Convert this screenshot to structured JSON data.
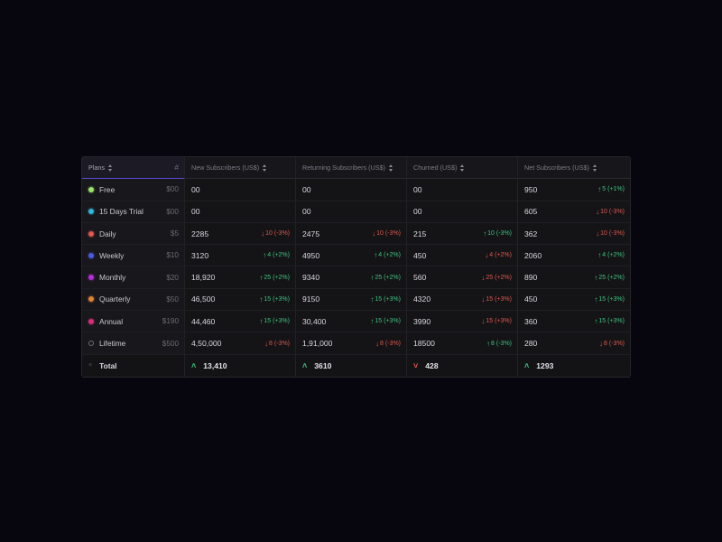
{
  "headers": {
    "plans": "Plans",
    "hash": "#",
    "new": "New Subscribers (US$)",
    "returning": "Returning Subscribers (US$)",
    "churned": "Churned (US$)",
    "net": "Net Subscribers (US$)"
  },
  "rows": [
    {
      "plan": "Free",
      "price": "$00",
      "dot": "#9be36b",
      "new": {
        "value": "00",
        "delta": "",
        "dir": ""
      },
      "ret": {
        "value": "00",
        "delta": "",
        "dir": ""
      },
      "churn": {
        "value": "00",
        "delta": "",
        "dir": ""
      },
      "net": {
        "value": "950",
        "delta": "5 (+1%)",
        "dir": "up"
      }
    },
    {
      "plan": "15 Days Trial",
      "price": "$00",
      "dot": "#2fb7d6",
      "new": {
        "value": "00",
        "delta": "",
        "dir": ""
      },
      "ret": {
        "value": "00",
        "delta": "",
        "dir": ""
      },
      "churn": {
        "value": "00",
        "delta": "",
        "dir": ""
      },
      "net": {
        "value": "605",
        "delta": "10 (-3%)",
        "dir": "down"
      }
    },
    {
      "plan": "Daily",
      "price": "$5",
      "dot": "#e0574f",
      "new": {
        "value": "2285",
        "delta": "10 (-3%)",
        "dir": "down"
      },
      "ret": {
        "value": "2475",
        "delta": "10 (-3%)",
        "dir": "down"
      },
      "churn": {
        "value": "215",
        "delta": "10 (-3%)",
        "dir": "up"
      },
      "net": {
        "value": "362",
        "delta": "10 (-3%)",
        "dir": "down"
      }
    },
    {
      "plan": "Weekly",
      "price": "$10",
      "dot": "#4a5be0",
      "new": {
        "value": "3120",
        "delta": "4 (+2%)",
        "dir": "up"
      },
      "ret": {
        "value": "4950",
        "delta": "4 (+2%)",
        "dir": "up"
      },
      "churn": {
        "value": "450",
        "delta": "4 (+2%)",
        "dir": "down"
      },
      "net": {
        "value": "2060",
        "delta": "4 (+2%)",
        "dir": "up"
      }
    },
    {
      "plan": "Monthly",
      "price": "$20",
      "dot": "#b32fd6",
      "new": {
        "value": "18,920",
        "delta": "25 (+2%)",
        "dir": "up"
      },
      "ret": {
        "value": "9340",
        "delta": "25 (+2%)",
        "dir": "up"
      },
      "churn": {
        "value": "560",
        "delta": "25 (+2%)",
        "dir": "down"
      },
      "net": {
        "value": "890",
        "delta": "25 (+2%)",
        "dir": "up"
      }
    },
    {
      "plan": "Quarterly",
      "price": "$50",
      "dot": "#e0842f",
      "new": {
        "value": "46,500",
        "delta": "15 (+3%)",
        "dir": "up"
      },
      "ret": {
        "value": "9150",
        "delta": "15 (+3%)",
        "dir": "up"
      },
      "churn": {
        "value": "4320",
        "delta": "15 (+3%)",
        "dir": "down"
      },
      "net": {
        "value": "450",
        "delta": "15 (+3%)",
        "dir": "up"
      }
    },
    {
      "plan": "Annual",
      "price": "$190",
      "dot": "#d62f78",
      "new": {
        "value": "44,460",
        "delta": "15 (+3%)",
        "dir": "up"
      },
      "ret": {
        "value": "30,400",
        "delta": "15 (+3%)",
        "dir": "up"
      },
      "churn": {
        "value": "3990",
        "delta": "15 (+3%)",
        "dir": "down"
      },
      "net": {
        "value": "360",
        "delta": "15 (+3%)",
        "dir": "up"
      }
    },
    {
      "plan": "Lifetime",
      "price": "$500",
      "dot": "ring",
      "new": {
        "value": "4,50,000",
        "delta": "8 (-3%)",
        "dir": "down"
      },
      "ret": {
        "value": "1,91,000",
        "delta": "8 (-3%)",
        "dir": "down"
      },
      "churn": {
        "value": "18500",
        "delta": "8 (-3%)",
        "dir": "up"
      },
      "net": {
        "value": "280",
        "delta": "8 (-3%)",
        "dir": "down"
      }
    }
  ],
  "total": {
    "label": "Total",
    "new": "13,410",
    "ret": "3610",
    "churn": "428",
    "net": "1293"
  },
  "colors": {
    "up": "#3ec27e",
    "down": "#e0574f",
    "accent": "#5a4bd6"
  },
  "icons": {
    "sort": "sort-icon",
    "up": "arrow-up-icon",
    "down": "arrow-down-icon",
    "total_up": "chevron-double-up-icon",
    "total_down": "chevron-double-down-icon"
  }
}
